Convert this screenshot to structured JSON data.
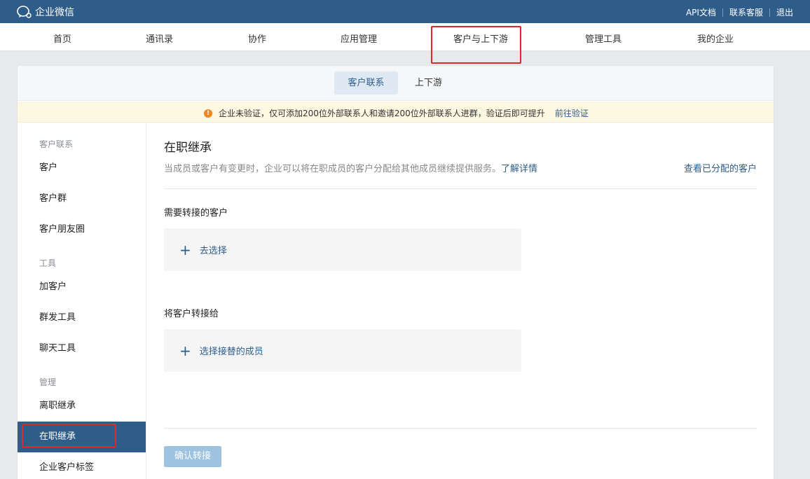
{
  "topbar": {
    "logo_text": "企业微信",
    "links": [
      "API文档",
      "联系客服",
      "退出"
    ]
  },
  "main_nav": [
    "首页",
    "通讯录",
    "协作",
    "应用管理",
    "客户与上下游",
    "管理工具",
    "我的企业"
  ],
  "sub_tabs": {
    "active": "客户联系",
    "other": "上下游"
  },
  "notice": {
    "text": "企业未验证，仅可添加200位外部联系人和邀请200位外部联系人进群，验证后即可提升",
    "link": "前往验证"
  },
  "sidebar": {
    "group1": "客户联系",
    "items1": [
      "客户",
      "客户群",
      "客户朋友圈"
    ],
    "group2": "工具",
    "items2": [
      "加客户",
      "群发工具",
      "聊天工具"
    ],
    "group3": "管理",
    "items3": [
      "离职继承",
      "在职继承",
      "企业客户标签"
    ]
  },
  "content": {
    "title": "在职继承",
    "desc": "当成员或客户有变更时，企业可以将在职成员的客户分配给其他成员继续提供服务。",
    "desc_link": "了解详情",
    "right_link": "查看已分配的客户",
    "section1_label": "需要转接的客户",
    "section1_picker": "去选择",
    "section2_label": "将客户转接给",
    "section2_picker": "选择接替的成员",
    "confirm_button": "确认转接"
  },
  "colors": {
    "brand": "#2f5d8a",
    "highlight_box": "#e0272a",
    "notice_bg": "#fdf8e2"
  }
}
